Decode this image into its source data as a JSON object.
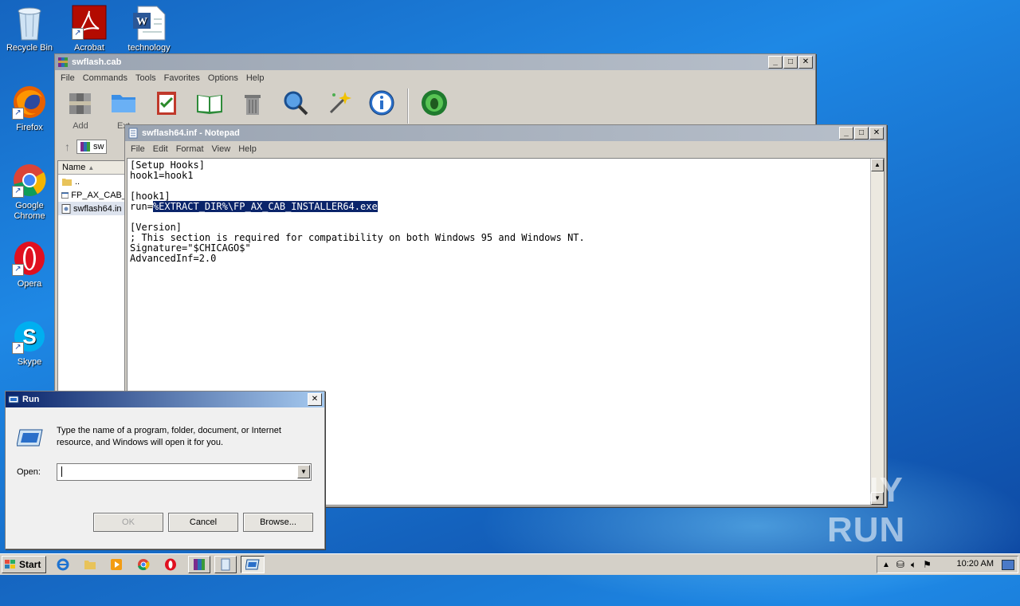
{
  "desktop": {
    "icons": [
      {
        "label": "Recycle Bin"
      },
      {
        "label": "Acrobat"
      },
      {
        "label": "technology"
      },
      {
        "label": "Firefox"
      },
      {
        "label": "Google Chrome"
      },
      {
        "label": "Opera"
      },
      {
        "label": "Skype"
      }
    ]
  },
  "winrar": {
    "title": "swflash.cab",
    "menu": [
      "File",
      "Commands",
      "Tools",
      "Favorites",
      "Options",
      "Help"
    ],
    "toolbar": [
      {
        "label": "Add"
      },
      {
        "label": "Ext"
      }
    ],
    "address_value": "sw",
    "column_name": "Name",
    "files": [
      {
        "name": ".."
      },
      {
        "name": "FP_AX_CAB_"
      },
      {
        "name": "swflash64.in"
      }
    ]
  },
  "notepad": {
    "title": "swflash64.inf - Notepad",
    "menu": [
      "File",
      "Edit",
      "Format",
      "View",
      "Help"
    ],
    "lines": {
      "l1": "[Setup Hooks]",
      "l2": "hook1=hook1",
      "l3": "",
      "l4": "[hook1]",
      "l5a": "run=",
      "l5b": "%EXTRACT_DIR%\\FP_AX_CAB_INSTALLER64.exe",
      "l6": "",
      "l7": "[Version]",
      "l8": "; This section is required for compatibility on both Windows 95 and Windows NT.",
      "l9": "Signature=\"$CHICAGO$\"",
      "l10": "AdvancedInf=2.0"
    }
  },
  "run": {
    "title": "Run",
    "description": "Type the name of a program, folder, document, or Internet resource, and Windows will open it for you.",
    "open_label": "Open:",
    "open_value": "",
    "ok_label": "OK",
    "cancel_label": "Cancel",
    "browse_label": "Browse..."
  },
  "taskbar": {
    "start_label": "Start",
    "clock": "10:20 AM"
  },
  "watermark": "ANY RUN"
}
